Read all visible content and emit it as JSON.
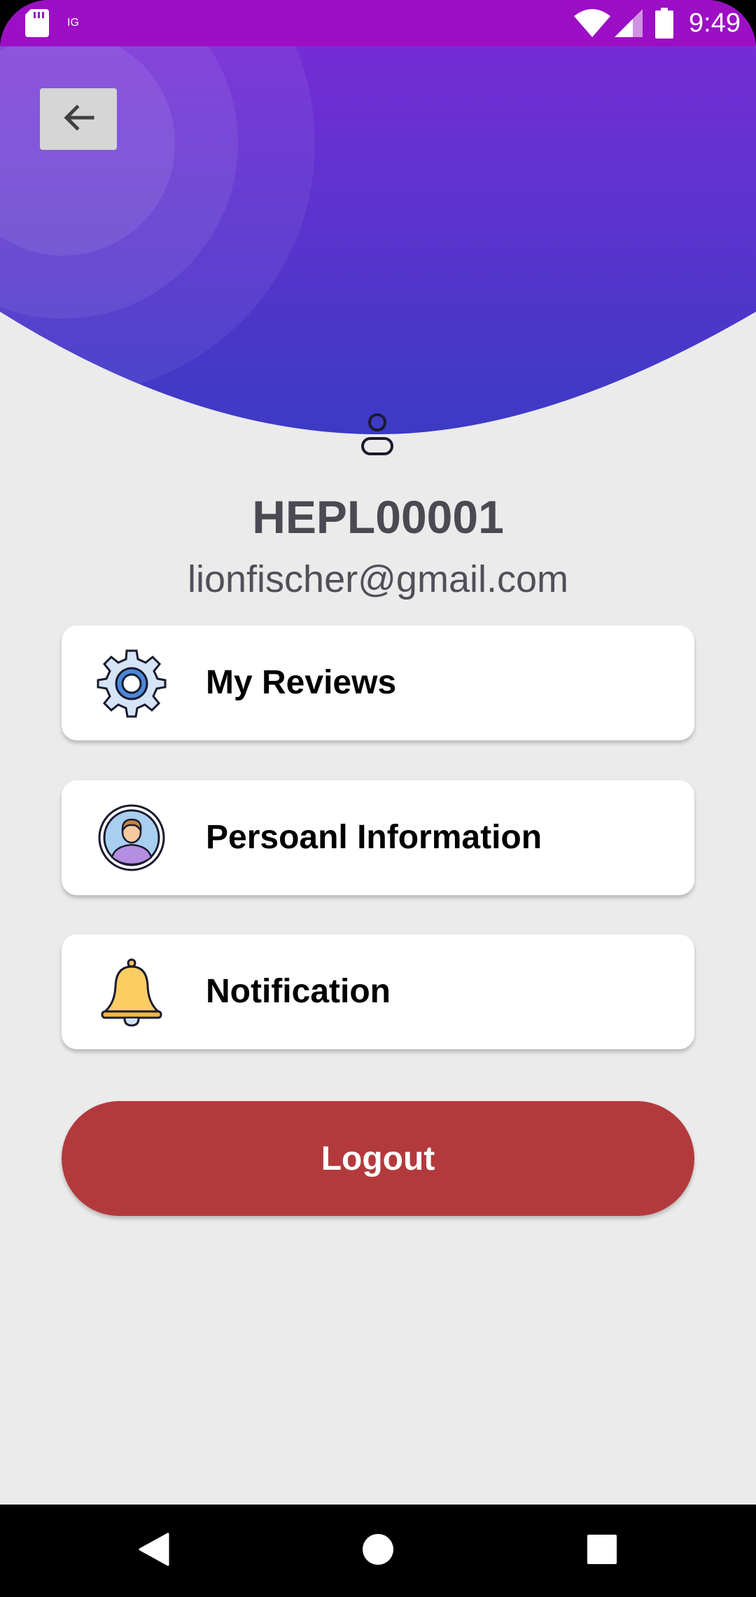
{
  "status_bar": {
    "time": "9:49"
  },
  "profile": {
    "user_id": "HEPL00001",
    "email": "lionfischer@gmail.com"
  },
  "menu": {
    "items": [
      {
        "label": "My Reviews",
        "icon": "gear-icon"
      },
      {
        "label": "Persoanl Information",
        "icon": "user-avatar-icon"
      },
      {
        "label": "Notification",
        "icon": "bell-icon"
      }
    ]
  },
  "logout": {
    "label": "Logout"
  },
  "colors": {
    "status_bar": "#9c0fc4",
    "header_top": "#7b35d9",
    "header_bottom": "#3a3bc4",
    "logout": "#b33a3c",
    "background": "#ebebeb"
  }
}
